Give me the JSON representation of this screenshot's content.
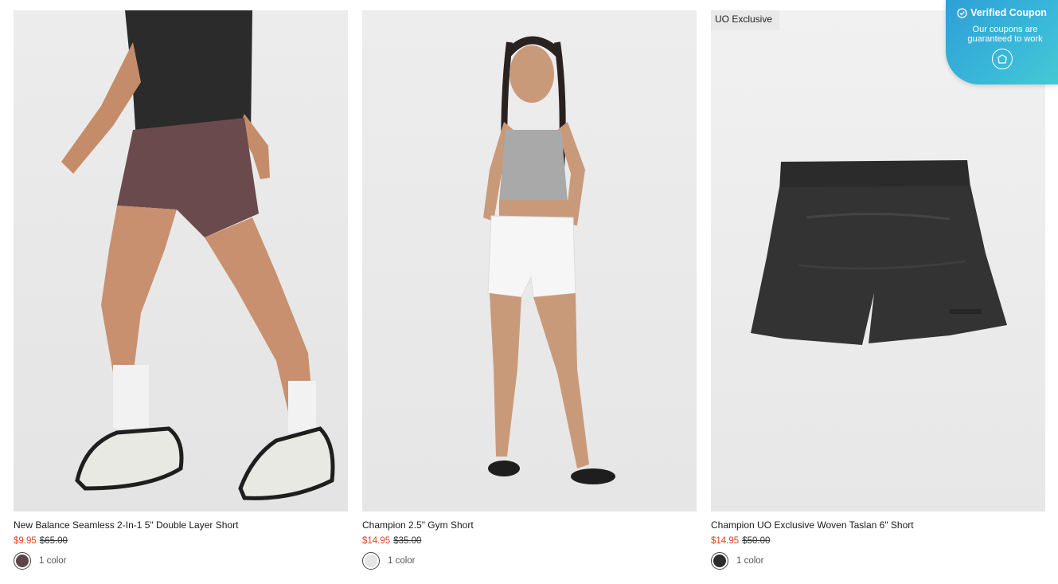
{
  "coupon": {
    "title": "Verified Coupon",
    "line1": "Our coupons are",
    "line2": "guaranteed to work",
    "check_icon": "check-circle-icon",
    "logo_icon": "shield-logo-icon"
  },
  "products": [
    {
      "name": "New Balance Seamless 2-In-1 5\" Double Layer Short",
      "sale_price": "$9.95",
      "original_price": "$65.00",
      "colors_label": "1 color",
      "swatch_color": "#5e4548"
    },
    {
      "name": "Champion 2.5\" Gym Short",
      "sale_price": "$14.95",
      "original_price": "$35.00",
      "colors_label": "1 color",
      "swatch_color": "#e6e6e6"
    },
    {
      "badge": "UO Exclusive",
      "name": "Champion UO Exclusive Woven Taslan 6\" Short",
      "sale_price": "$14.95",
      "original_price": "$50.00",
      "colors_label": "1 color",
      "swatch_color": "#2c2c2c"
    }
  ],
  "colors": {
    "sale_red": "#e2421b",
    "coupon_blue": "#2f9fd6"
  }
}
